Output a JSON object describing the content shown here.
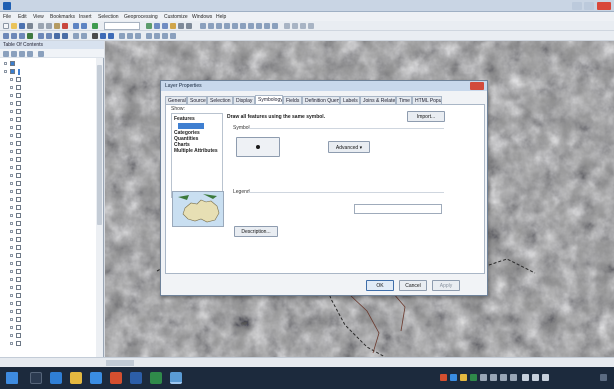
{
  "window": {
    "title": "",
    "colors": {
      "titlebar": "#c9d5e4",
      "close": "#d9473a",
      "accent": "#3f7fd1"
    }
  },
  "menu": [
    "File",
    "Edit",
    "View",
    "Bookmarks",
    "Insert",
    "Selection",
    "Geoprocessing",
    "Customize",
    "Windows",
    "Help"
  ],
  "toolbar": {
    "scale_value": "",
    "icons": [
      "new-icon",
      "open-icon",
      "save-icon",
      "print-icon",
      "cut-icon",
      "copy-icon",
      "paste-icon",
      "delete-icon",
      "undo-icon",
      "redo-icon",
      "add-data-icon",
      "zoom-in-icon",
      "zoom-out-icon",
      "pan-icon",
      "full-extent-icon",
      "identify-icon",
      "find-icon",
      "measure-icon",
      "select-icon",
      "editor-icon"
    ]
  },
  "toc": {
    "title": "Table Of Contents",
    "layers": [
      {
        "label": "",
        "checked": true,
        "selected": false
      },
      {
        "label": "",
        "checked": true,
        "selected": true
      },
      {
        "label": "",
        "checked": false,
        "selected": false
      },
      {
        "label": "",
        "checked": false,
        "selected": false
      },
      {
        "label": "",
        "checked": false,
        "selected": false
      },
      {
        "label": "",
        "checked": false,
        "selected": false
      },
      {
        "label": "",
        "checked": false,
        "selected": false
      },
      {
        "label": "",
        "checked": false,
        "selected": false
      },
      {
        "label": "",
        "checked": false,
        "selected": false
      },
      {
        "label": "",
        "checked": false,
        "selected": false
      },
      {
        "label": "",
        "checked": false,
        "selected": false
      },
      {
        "label": "",
        "checked": false,
        "selected": false
      },
      {
        "label": "",
        "checked": false,
        "selected": false
      },
      {
        "label": "",
        "checked": false,
        "selected": false
      },
      {
        "label": "",
        "checked": false,
        "selected": false
      },
      {
        "label": "",
        "checked": false,
        "selected": false
      },
      {
        "label": "",
        "checked": false,
        "selected": false
      },
      {
        "label": "",
        "checked": false,
        "selected": false
      },
      {
        "label": "",
        "checked": false,
        "selected": false
      },
      {
        "label": "",
        "checked": false,
        "selected": false
      },
      {
        "label": "",
        "checked": false,
        "selected": false
      },
      {
        "label": "",
        "checked": false,
        "selected": false
      },
      {
        "label": "",
        "checked": false,
        "selected": false
      },
      {
        "label": "",
        "checked": false,
        "selected": false
      },
      {
        "label": "",
        "checked": false,
        "selected": false
      },
      {
        "label": "",
        "checked": false,
        "selected": false
      },
      {
        "label": "",
        "checked": false,
        "selected": false
      },
      {
        "label": "",
        "checked": false,
        "selected": false
      },
      {
        "label": "",
        "checked": false,
        "selected": false
      },
      {
        "label": "",
        "checked": false,
        "selected": false
      },
      {
        "label": "",
        "checked": false,
        "selected": false
      },
      {
        "label": "",
        "checked": false,
        "selected": false
      },
      {
        "label": "",
        "checked": false,
        "selected": false
      },
      {
        "label": "",
        "checked": false,
        "selected": false
      },
      {
        "label": "",
        "checked": false,
        "selected": false
      },
      {
        "label": "",
        "checked": false,
        "selected": false
      }
    ]
  },
  "dialog": {
    "title": "Layer Properties",
    "tabs": [
      "General",
      "Source",
      "Selection",
      "Display",
      "Symbology",
      "Fields",
      "Definition Query",
      "Labels",
      "Joins & Relates",
      "Time",
      "HTML Popup"
    ],
    "active_tab": "Symbology",
    "show_label": "Show:",
    "show_items": [
      "Features",
      "",
      "Categories",
      "Quantities",
      "Charts",
      "Multiple Attributes"
    ],
    "selected_show_index": 1,
    "heading": "Draw all features using the same symbol.",
    "import_label": "Import...",
    "symbol_label": "Symbol",
    "advanced_label": "Advanced",
    "legend_label": "Legend",
    "legend_prompt": "",
    "label_value": "",
    "description_label": "Description...",
    "description_note": "",
    "ok_label": "OK",
    "cancel_label": "Cancel",
    "apply_label": "Apply"
  },
  "status": {
    "coordinates": ""
  },
  "taskbar": {
    "icons": [
      "start-icon",
      "search-icon",
      "edge-icon",
      "file-explorer-icon",
      "store-icon",
      "office-icon",
      "word-icon",
      "excel-icon",
      "arcmap-icon"
    ],
    "clock": ""
  }
}
